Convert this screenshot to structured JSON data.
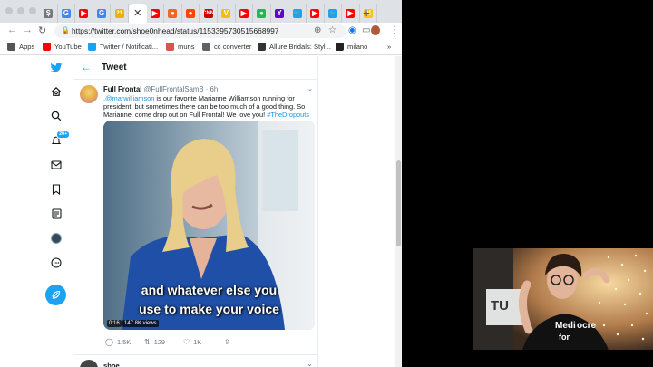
{
  "browser": {
    "tabs": [
      {
        "icon": "s-script",
        "glyph": "Ș",
        "color": "#777777"
      },
      {
        "icon": "google-g",
        "glyph": "G",
        "color": "#4285f4"
      },
      {
        "icon": "youtube",
        "glyph": "▶",
        "color": "#ff0000"
      },
      {
        "icon": "google-g",
        "glyph": "G",
        "color": "#4285f4"
      },
      {
        "icon": "number-21",
        "glyph": "21",
        "color": "#e8b400"
      },
      {
        "icon": "close",
        "glyph": "✕",
        "color": "#333333"
      },
      {
        "icon": "youtube",
        "glyph": "▶",
        "color": "#ff0000"
      },
      {
        "icon": "orange-circle",
        "glyph": "●",
        "color": "#f26522"
      },
      {
        "icon": "reddit",
        "glyph": "●",
        "color": "#ff4500"
      },
      {
        "icon": "cnn",
        "glyph": "CNN",
        "color": "#cc0000"
      },
      {
        "icon": "vice-v",
        "glyph": "V",
        "color": "#f0c000"
      },
      {
        "icon": "youtube",
        "glyph": "▶",
        "color": "#ff0000"
      },
      {
        "icon": "spotify",
        "glyph": "●",
        "color": "#1db954"
      },
      {
        "icon": "yahoo-y",
        "glyph": "Y",
        "color": "#6001d2"
      },
      {
        "icon": "twitter",
        "glyph": "🐦",
        "color": "#1da1f2"
      },
      {
        "icon": "youtube",
        "glyph": "▶",
        "color": "#ff0000"
      },
      {
        "icon": "twitter",
        "glyph": "🐦",
        "color": "#1da1f2"
      },
      {
        "icon": "youtube",
        "glyph": "▶",
        "color": "#ff0000"
      },
      {
        "icon": "yellow-n",
        "glyph": "N",
        "color": "#f5c518"
      }
    ],
    "url": "https://twitter.com/shoe0nhead/status/1153395730515668997",
    "bookmarks": [
      {
        "label": "Apps",
        "icon": "apps-grid-icon",
        "color": "#555555"
      },
      {
        "label": "YouTube",
        "icon": "youtube-icon",
        "color": "#ff0000"
      },
      {
        "label": "Twitter / Notificati...",
        "icon": "twitter-icon",
        "color": "#1da1f2"
      },
      {
        "label": "muns",
        "icon": "muns-icon",
        "color": "#d9534f"
      },
      {
        "label": "cc converter",
        "icon": "converter-icon",
        "color": "#5f6368"
      },
      {
        "label": "Allure Bridals: Styl...",
        "icon": "allure-a-icon",
        "color": "#333333"
      },
      {
        "label": "milano",
        "icon": "milano-icon",
        "color": "#222222"
      }
    ],
    "bookmarks_more": "»"
  },
  "twitter": {
    "header_title": "Tweet",
    "author_name": "Full Frontal",
    "author_handle": "@FullFrontalSamB",
    "author_time": "· 6h",
    "tweet_mention": ".@marwilliamson",
    "tweet_body": " is our favorite Marianne Williamson running for president, but sometimes there can be too much of a good thing. So Marianne, come drop out on Full Frontal! We love you! ",
    "tweet_hashtag": "#TheDropouts",
    "caption_line1": "and whatever else you",
    "caption_line2": "use to make your voice",
    "video_time": "0:16",
    "video_views": "147.8K views",
    "reply_count": "1.5K",
    "retweet_count": "129",
    "like_count": "1K",
    "next_reply_name": "shoe",
    "notification_badge": "20+",
    "brand_color": "#1da1f2"
  },
  "webcam": {
    "shirt_text_line1": "Medi",
    "shirt_text_line2": "ocre",
    "shirt_text_line3": "for",
    "poster_text": "TU"
  }
}
